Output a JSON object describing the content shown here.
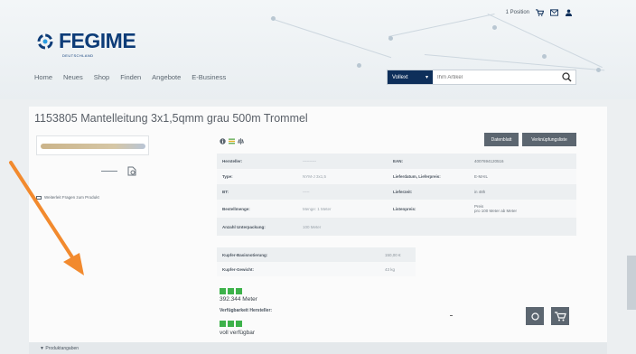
{
  "header": {
    "topbar": {
      "positions": "1 Position"
    },
    "brand": "FEGIME",
    "brand_sub": "DEUTSCHLAND",
    "nav": [
      "Home",
      "Neues",
      "Shop",
      "Finden",
      "Angebote",
      "E-Business"
    ],
    "search": {
      "scope": "Vollext",
      "placeholder": "Ihm Artikel"
    }
  },
  "product": {
    "title": "1153805 Mantelleitung 3x1,5qmm grau 500m Trommel",
    "mail_link": "Weiterleit Fragen zum Produkt",
    "buttons": {
      "datasheet": "Datenblatt",
      "compare": "Verknüpfungsliste"
    },
    "specs": [
      {
        "k1": "Hersteller:",
        "v1": "----------",
        "k2": "EAN:",
        "v2": "4007694120516"
      },
      {
        "k1": "Type:",
        "v1": "NYM-J 3x1,5",
        "k2": "Lieferdatum, Lieferpreis:",
        "v2": "E-MAIL"
      },
      {
        "k1": "BT:",
        "v1": "-----",
        "k2": "Lieferzeit:",
        "v2": "in 48h"
      },
      {
        "k1": "Bestellmenge:",
        "v1": "Menge: 1 Meter",
        "k2": "Listenpreis:",
        "v2": "Preis",
        "v2b": "pro 100 Meter ab Meter"
      },
      {
        "k1": "Anzahl Unterpackung:",
        "v1": "100 Meter"
      }
    ],
    "kupfer_basis": {
      "label": "Kupfer-Basisnotierung:",
      "value": "150,00 €"
    },
    "kupfer_gewicht": {
      "label": "Kupfer-Gewicht:",
      "value": "43 kg"
    },
    "stock_qty": "392.344 Meter",
    "verfuegbarkeit_label": "Verfügbarkeit Hersteller:",
    "availability": "voll verfügbar"
  },
  "footer": {
    "label": "▼ Produktangaben"
  },
  "colors": {
    "brand_blue": "#0d3c78",
    "stock_green": "#3db24a",
    "button_gray": "#5c6670",
    "arrow": "#f28a2e"
  }
}
